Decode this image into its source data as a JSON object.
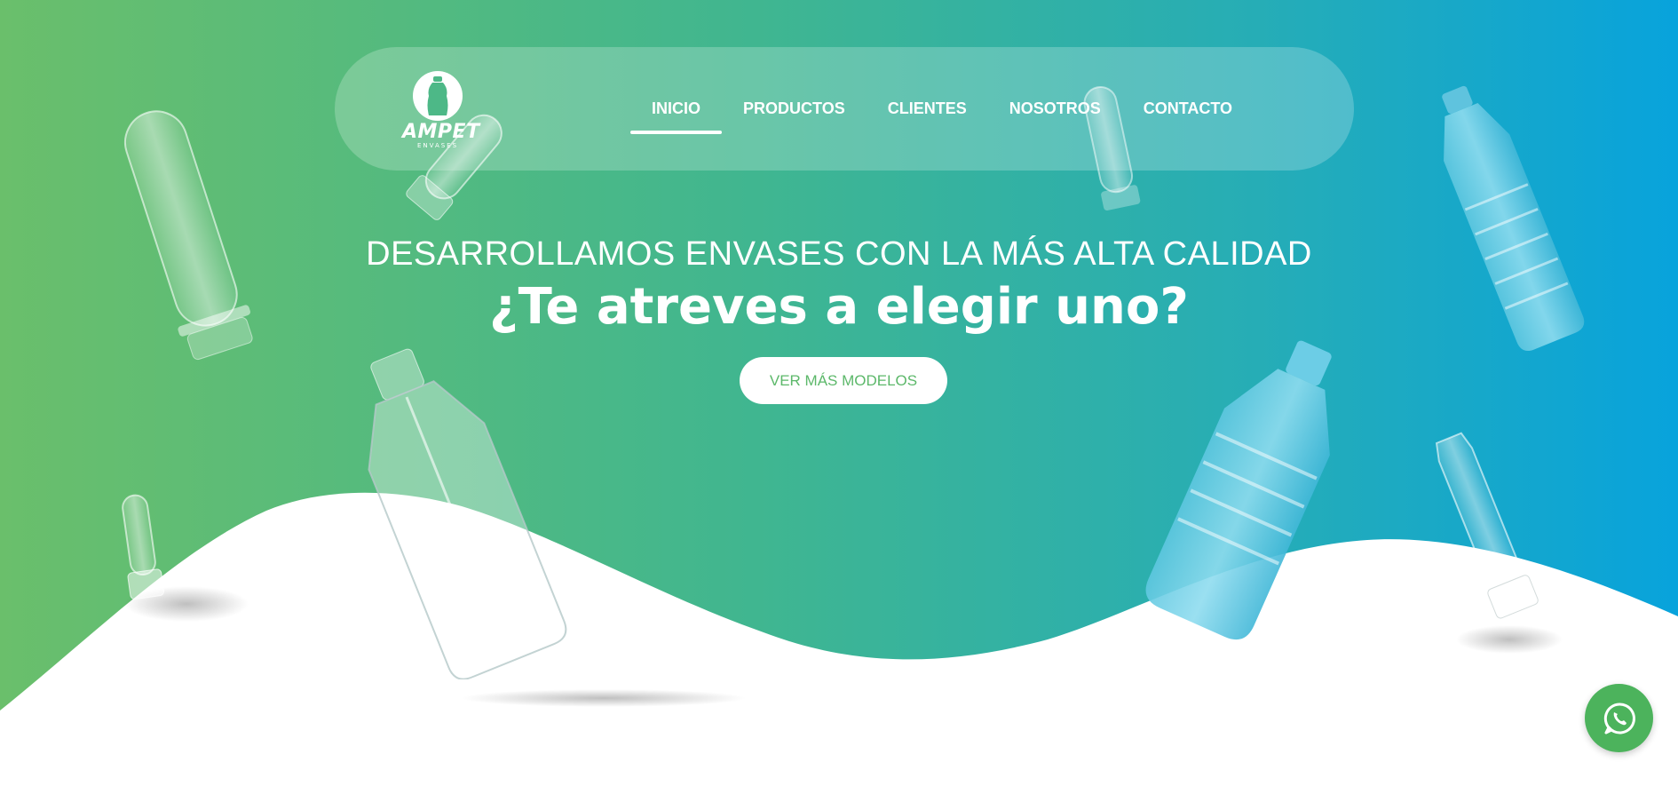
{
  "brand": {
    "name": "AMPET",
    "sub": "ENVASES"
  },
  "nav": {
    "items": [
      {
        "label": "INICIO",
        "active": true
      },
      {
        "label": "PRODUCTOS",
        "active": false
      },
      {
        "label": "CLIENTES",
        "active": false
      },
      {
        "label": "NOSOTROS",
        "active": false
      },
      {
        "label": "CONTACTO",
        "active": false
      }
    ]
  },
  "hero": {
    "headline": "DESARROLLAMOS ENVASES CON LA MÁS ALTA CALIDAD",
    "tagline": "¿Te atreves a elegir uno?",
    "cta_label": "VER MÁS MODELOS"
  },
  "colors": {
    "gradient_start": "#6abf6b",
    "gradient_mid": "#3cb59a",
    "gradient_end": "#0aa3d8",
    "cta_text": "#5cb86a",
    "whatsapp": "#4cb35c"
  },
  "icons": {
    "whatsapp": "whatsapp-icon",
    "logo": "bottle-logo-icon"
  }
}
